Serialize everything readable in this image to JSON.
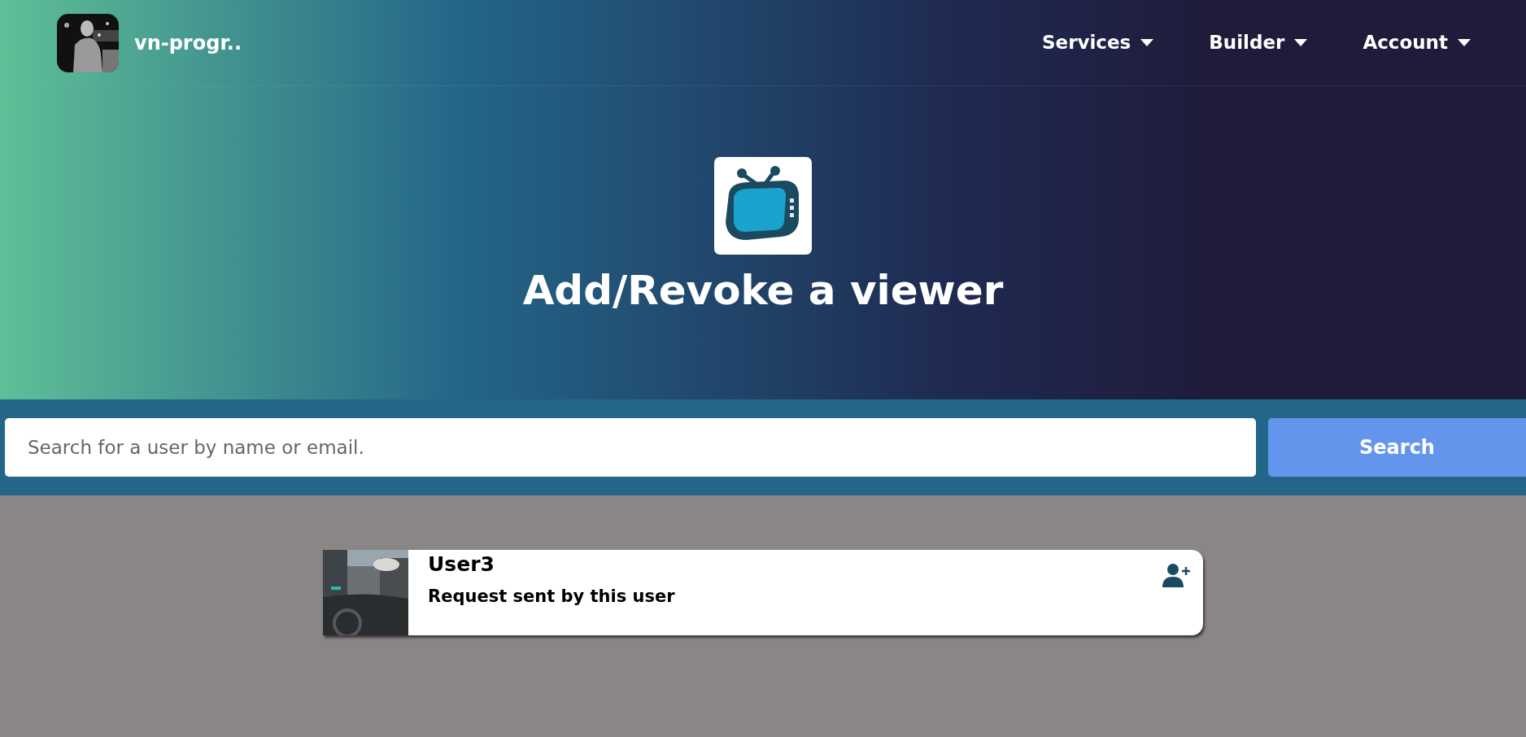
{
  "navbar": {
    "brand": "vn-progr..",
    "items": [
      {
        "label": "Services"
      },
      {
        "label": "Builder"
      },
      {
        "label": "Account"
      }
    ]
  },
  "hero": {
    "title": "Add/Revoke a viewer"
  },
  "search": {
    "placeholder": "Search for a user by name or email.",
    "button": "Search"
  },
  "users": [
    {
      "name": "User3",
      "status": "Request sent by this user"
    }
  ]
}
